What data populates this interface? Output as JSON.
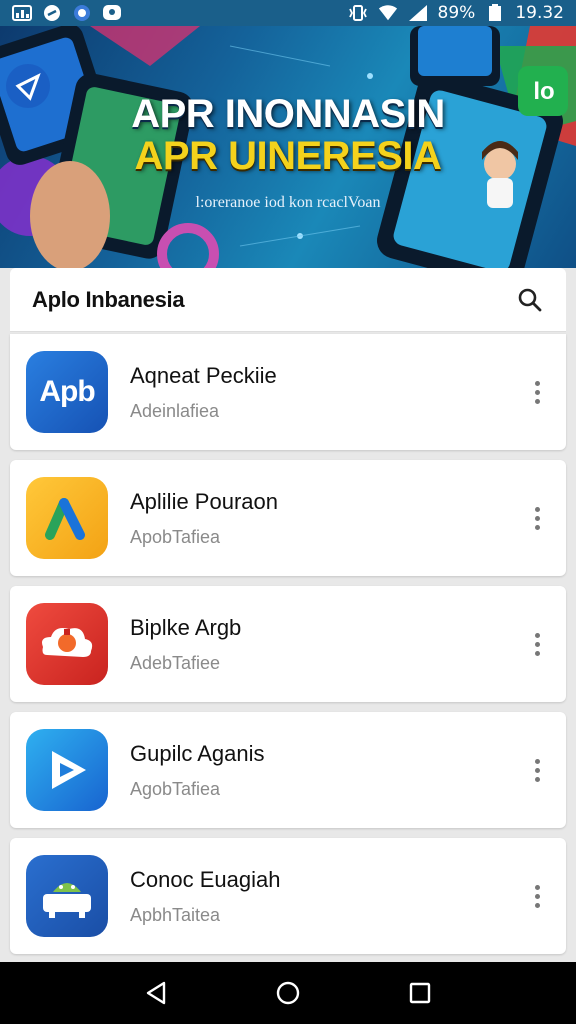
{
  "status_bar": {
    "battery_percent": "89%",
    "time": "19.32",
    "icons": [
      "gallery-icon",
      "link-icon",
      "messenger-icon",
      "chat-icon",
      "vibrate-icon",
      "wifi-icon",
      "signal-icon",
      "battery-icon"
    ]
  },
  "banner": {
    "title_line1": "APR INONNASIN",
    "title_line2": "APR UINERESIA",
    "subtitle": "l:oreranoe iod kon rcaclVoan",
    "corner_badge": "lo"
  },
  "header": {
    "title": "Aplo Inbanesia",
    "search_icon": "search-icon"
  },
  "apps": [
    {
      "name": "Aqneat Peckiie",
      "subtitle": "Adeinlafiea",
      "icon": "apb-logo-icon",
      "icon_text": "Apb",
      "color": "#1b63c6"
    },
    {
      "name": "Aplilie Pouraon",
      "subtitle": "ApobTafiea",
      "icon": "ads-logo-icon",
      "icon_text": "",
      "color": "#f6b61c"
    },
    {
      "name": "Biplke Argb",
      "subtitle": "AdebTafiee",
      "icon": "cloud-robot-icon",
      "icon_text": "",
      "color": "#e2312c"
    },
    {
      "name": "Gupilc Aganis",
      "subtitle": "AgobTafiea",
      "icon": "play-logo-icon",
      "icon_text": "",
      "color": "#1b86e0"
    },
    {
      "name": "Conoc Euagiah",
      "subtitle": "ApbhTaitea",
      "icon": "android-icon",
      "icon_text": "",
      "color": "#1d5fb8"
    }
  ],
  "nav": {
    "back": "back-icon",
    "home": "home-icon",
    "recents": "recents-icon"
  }
}
